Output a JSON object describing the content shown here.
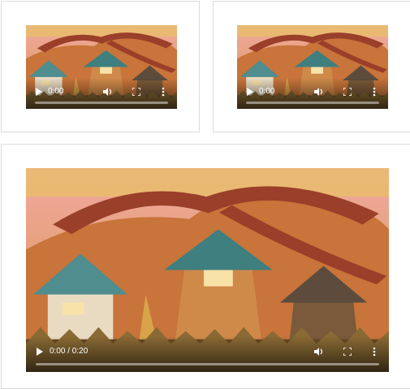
{
  "videos": [
    {
      "time_label": "0:00",
      "progress": 0,
      "buttons": [
        "play",
        "volume",
        "fullscreen",
        "more-options"
      ]
    },
    {
      "time_label": "0:00",
      "progress": 0,
      "buttons": [
        "play",
        "volume",
        "fullscreen",
        "more-options"
      ]
    },
    {
      "time_label": "0:00 / 0:20",
      "progress": 0,
      "buttons": [
        "play",
        "volume",
        "fullscreen",
        "more-options"
      ]
    }
  ],
  "colors": {
    "sky": "#f0a9a0",
    "tree": "#a04a2c",
    "roof": "#3f7f80",
    "ground": "#6b4a26"
  }
}
